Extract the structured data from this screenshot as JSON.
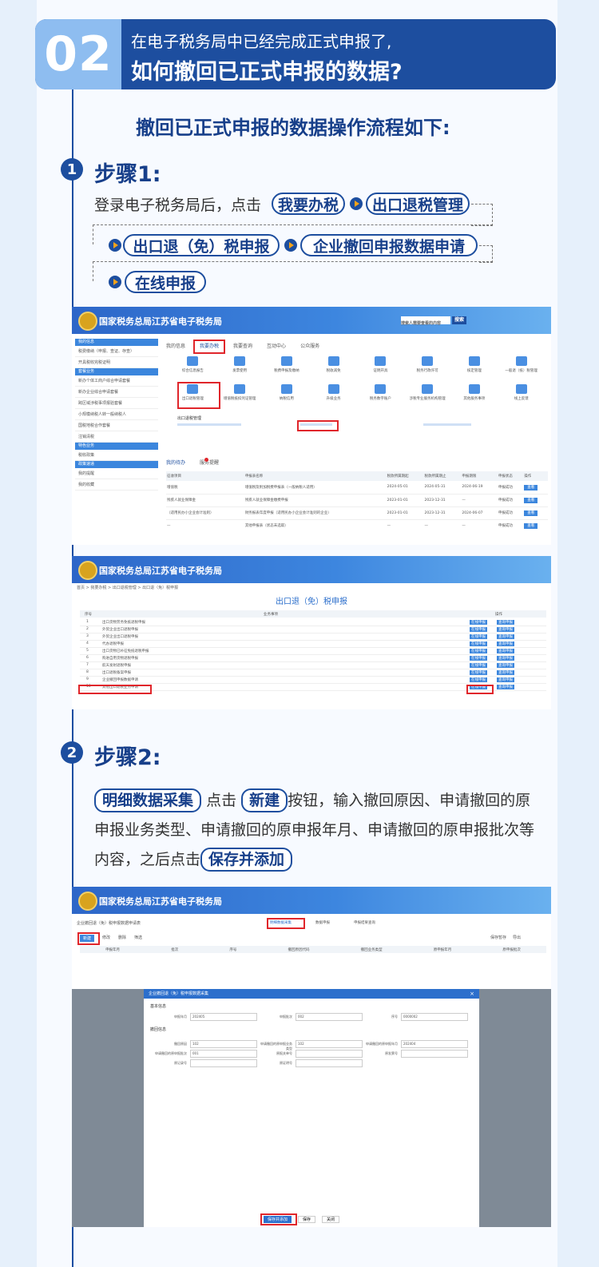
{
  "header": {
    "number": "02",
    "line1": "在电子税务局中已经完成正式申报了,",
    "line2": "如何撤回已正式申报的数据?"
  },
  "flow_title": "撤回已正式申报的数据操作流程如下:",
  "step1": {
    "badge": "1",
    "title": "步骤1:",
    "intro": "登录电子税务局后，点击",
    "pills": [
      "我要办税",
      "出口退税管理",
      "出口退（免）税申报",
      "企业撤回申报数据申请",
      "在线申报"
    ]
  },
  "step2": {
    "badge": "2",
    "title": "步骤2:",
    "pill1": "明细数据采集",
    "t1": "点击",
    "pill2": "新建",
    "t2": "按钮，输入撤回原因、申请撤回的原申报业务类型、申请撤回的原申报年月、申请撤回的原申报批次等内容，之后点击",
    "pill3": "保存并添加"
  },
  "shot1": {
    "site_title": "国家税务总局江苏省电子税务局",
    "search_placeholder": "搜索人需要查看的内容",
    "search_button": "搜索",
    "tabs": [
      "我的信息",
      "我要办税",
      "我要查询",
      "互动中心",
      "公众服务"
    ],
    "sidebar_heads": [
      "我的信息",
      "套餐业务",
      "特色业务",
      "政策速递"
    ],
    "sidebar_items": [
      "税费缴纳（申报、查证、存查）",
      "开具税收完税证明",
      "新办个体工商户综合申请套餐",
      "新办企业综合申请套餐",
      "跨区域涉税事项报验套餐",
      "小规模纳税人转一般纳税人",
      "国税地税合作套餐",
      "注销清税",
      "税收政策",
      "我的提醒",
      "我的收藏"
    ],
    "icons": [
      "综合信息报告",
      "发票使用",
      "税费申报及缴纳",
      "税收减免",
      "证明开具",
      "税务行政许可",
      "核定管理",
      "一般退（抵）税管理",
      "出口退税管理",
      "增值税抵扣凭证管理",
      "纳税信用",
      "升级业务",
      "税务数字账户",
      "涉税专业服务机构管理",
      "其他服务事项",
      "线上反馈"
    ],
    "sub_title": "出口退税管理",
    "bottom_tabs": [
      "我的待办",
      "服务提醒"
    ],
    "table_headers": [
      "征收项目",
      "申报表名称",
      "税款所属期起",
      "税款所属期止",
      "申报期限",
      "申报状态",
      "操作"
    ],
    "table_rows": [
      [
        "增值税",
        "增值税及附加税费申报表（一般纳税人适用）",
        "2024-05-01",
        "2024-05-31",
        "2024-06-19",
        "申报成功",
        "查看"
      ],
      [
        "残疾人就业保障金",
        "残疾人就业保障金缴费申报",
        "2023-01-01",
        "2023-12-31",
        "—",
        "申报成功",
        "查看"
      ],
      [
        "（适用民办小企业会计准则）",
        "财务报表年度申报（适用民办小企业会计准则的企业）",
        "2023-01-01",
        "2023-12-31",
        "2024-06-07",
        "申报成功",
        "查看"
      ],
      [
        "—",
        "其他申报表（状态未选取）",
        "—",
        "—",
        "—",
        "申报成功",
        "查看"
      ]
    ]
  },
  "shot2": {
    "site_title": "国家税务总局江苏省电子税务局",
    "breadcrumb": "首页 > 我要办税 > 出口退税管理 > 出口退（免）税申报",
    "heading": "出口退（免）税申报",
    "col_no": "序号",
    "col_item": "业务事项",
    "col_op": "操作",
    "rows": [
      "出口货物劳务免抵退税申报",
      "外贸企业出口退税申报",
      "外贸企业出口退税申报",
      "代办退税申报",
      "出口货物已补征免抵退税申报",
      "购进自用货物退税申报",
      "航天发射退税申报",
      "出口退税备案申报",
      "企业撤回申报数据申请",
      "其他出口退税业务申请"
    ],
    "btn_online": "在线申报",
    "btn_query": "查询申报"
  },
  "shot3": {
    "site_title": "国家税务总局江苏省电子税务局",
    "form_name": "企业撤回退（免）税申报数据申请表",
    "steps": [
      "明细数据采集",
      "数据申报",
      "申报结果查询"
    ],
    "toolbar": [
      "新建",
      "修改",
      "删除",
      "筛选"
    ],
    "right_buttons": [
      "保存暂存",
      "导出"
    ],
    "col_headers": [
      "申报年月",
      "批次",
      "序号",
      "撤回原因代码",
      "撤回业务类型",
      "原申报年月",
      "原申报批次"
    ]
  },
  "shot4": {
    "dialog_title": "企业撤回退（免）税申报数据采集",
    "section1": "基本信息",
    "section2": "撤回信息",
    "fields": [
      {
        "label": "申报年月",
        "value": "202405"
      },
      {
        "label": "申报批次",
        "value": "002"
      },
      {
        "label": "序号",
        "value": "0000002"
      },
      {
        "label": "撤回原因",
        "value": "102"
      },
      {
        "label": "申请撤回的原申报业务类型",
        "value": "102"
      },
      {
        "label": "申请撤回的原申报年月",
        "value": "202404"
      },
      {
        "label": "申请撤回的原申报批次",
        "value": "001"
      },
      {
        "label": "原报关单号",
        "value": ""
      },
      {
        "label": "原发票号",
        "value": ""
      },
      {
        "label": "原记录号",
        "value": ""
      },
      {
        "label": "原证明号",
        "value": ""
      }
    ],
    "buttons": [
      "保存并添加",
      "保存",
      "关闭"
    ]
  }
}
